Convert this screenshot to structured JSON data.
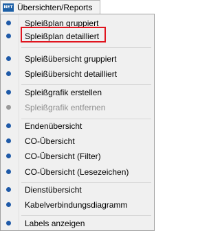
{
  "menubar": {
    "icon_text": "NET",
    "menu_label": "Übersichten/Reports"
  },
  "menu": {
    "items": [
      {
        "label": "Spleißplan gruppiert",
        "enabled": true
      },
      {
        "label": "Spleißplan detailliert",
        "enabled": true,
        "highlighted": true
      },
      {
        "label": "Spleißübersicht gruppiert",
        "enabled": true
      },
      {
        "label": "Spleißübersicht detailliert",
        "enabled": true
      },
      {
        "label": "Spleißgrafik erstellen",
        "enabled": true
      },
      {
        "label": "Spleißgrafik entfernen",
        "enabled": false
      },
      {
        "label": "Endenübersicht",
        "enabled": true
      },
      {
        "label": "CO-Übersicht",
        "enabled": true
      },
      {
        "label": "CO-Übersicht (Filter)",
        "enabled": true
      },
      {
        "label": "CO-Übersicht (Lesezeichen)",
        "enabled": true
      },
      {
        "label": "Dienstübersicht",
        "enabled": true
      },
      {
        "label": "Kabelverbindungsdiagramm",
        "enabled": true
      },
      {
        "label": "Labels anzeigen",
        "enabled": true
      }
    ]
  },
  "colors": {
    "bullet": "#1f5aa8",
    "bullet_disabled": "#9a9a9a",
    "highlight_border": "#e0141e",
    "menu_background": "#f0f0f0"
  }
}
